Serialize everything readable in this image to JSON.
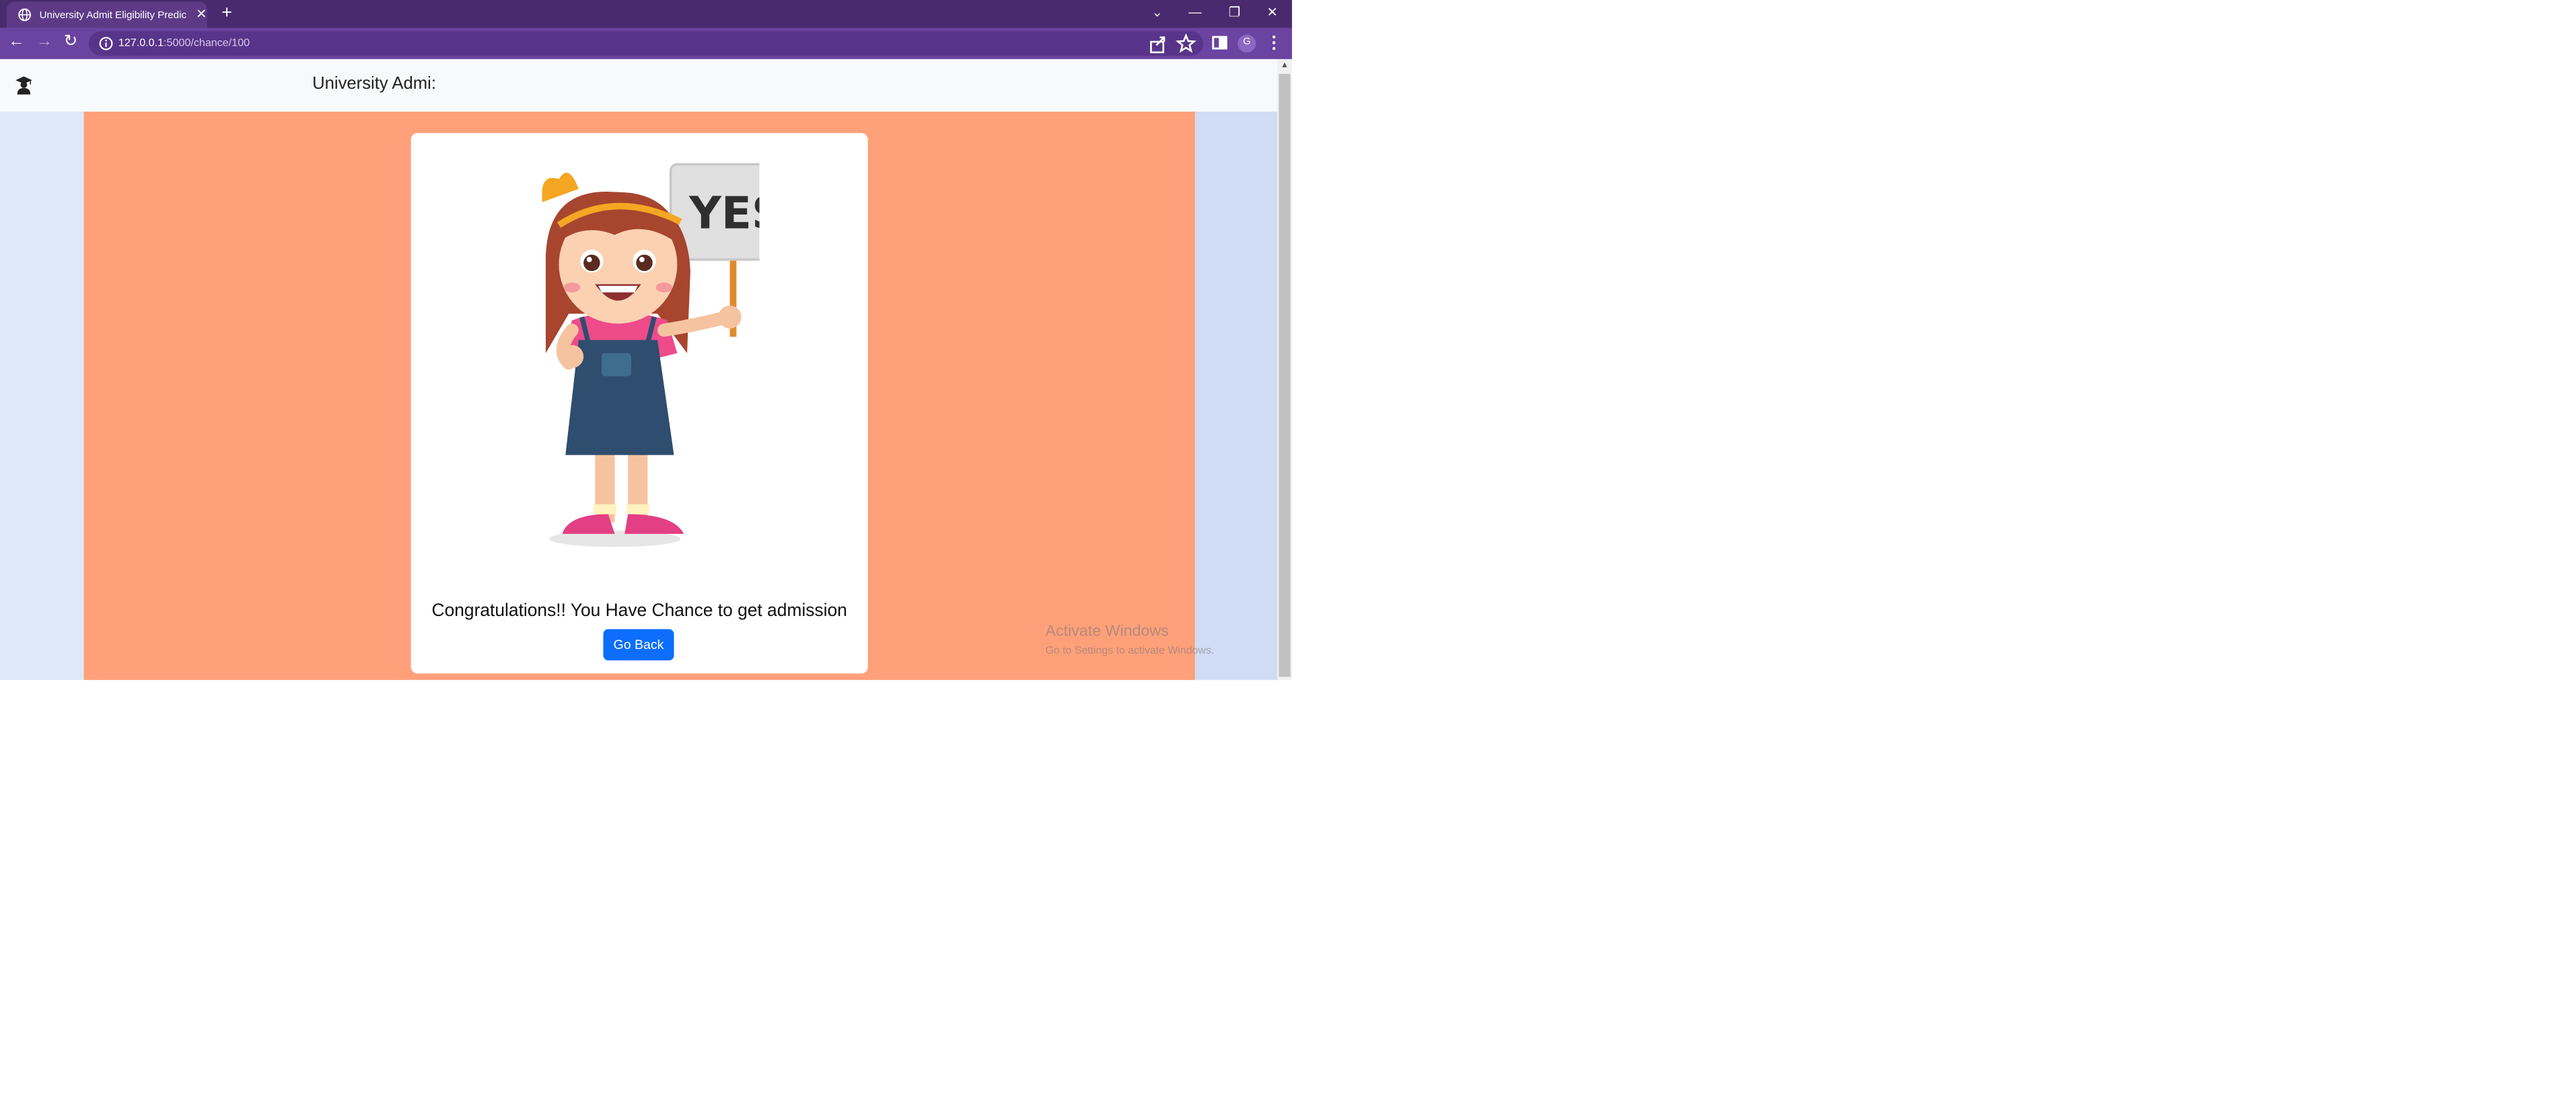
{
  "browser": {
    "tab_title": "University Admit Eligibility Predic",
    "tab_close_glyph": "✕",
    "new_tab_glyph": "+",
    "url_host": "127.0.0.1",
    "url_path": ":5000/chance/100",
    "profile_initial": "G",
    "window_controls": {
      "dropdown": "⌄",
      "minimize": "—",
      "restore": "❐",
      "close": "✕"
    },
    "nav": {
      "back": "←",
      "forward": "→",
      "reload": "↻"
    },
    "icons": [
      "site-info-icon",
      "share-icon",
      "star-icon",
      "sidepanel-icon",
      "menu-icon"
    ]
  },
  "page": {
    "navbar_title": "University Admi:",
    "message": "Congratulations!! You Have Chance to get admission",
    "button_label": "Go Back",
    "sign_text": "YES",
    "colors": {
      "main_bg": "#ffa07a",
      "button": "#0d6efd",
      "side_bg": "#dfe8f7",
      "browser_frame": "#4a2a6e"
    }
  },
  "os": {
    "watermark_title": "Activate Windows",
    "watermark_sub": "Go to Settings to activate Windows."
  }
}
